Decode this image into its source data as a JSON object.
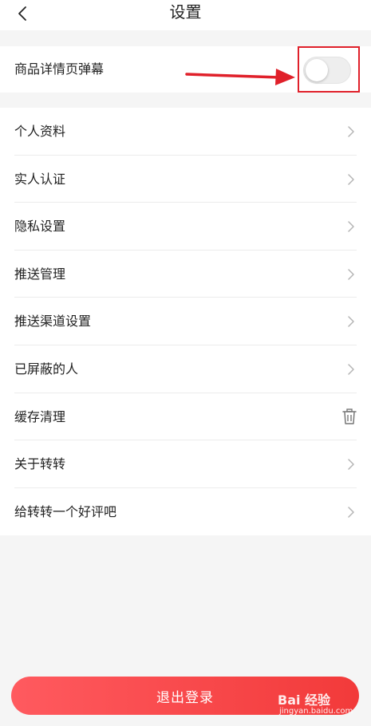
{
  "header": {
    "title": "设置"
  },
  "popup_setting": {
    "label": "商品详情页弹幕",
    "enabled": false
  },
  "menu": {
    "items": [
      {
        "label": "个人资料",
        "icon": "chevron-right-icon"
      },
      {
        "label": "实人认证",
        "icon": "chevron-right-icon"
      },
      {
        "label": "隐私设置",
        "icon": "chevron-right-icon"
      },
      {
        "label": "推送管理",
        "icon": "chevron-right-icon"
      },
      {
        "label": "推送渠道设置",
        "icon": "chevron-right-icon"
      },
      {
        "label": "已屏蔽的人",
        "icon": "chevron-right-icon"
      },
      {
        "label": "缓存清理",
        "icon": "trash-icon"
      },
      {
        "label": "关于转转",
        "icon": "chevron-right-icon"
      },
      {
        "label": "给转转一个好评吧",
        "icon": "chevron-right-icon"
      }
    ]
  },
  "footer": {
    "logout_label": "退出登录"
  },
  "watermark": {
    "brand": "Bai 经验",
    "url": "jingyan.baidu.com"
  },
  "colors": {
    "accent": "#f23a3a",
    "annotation": "#e0202a",
    "background": "#f5f5f5"
  }
}
